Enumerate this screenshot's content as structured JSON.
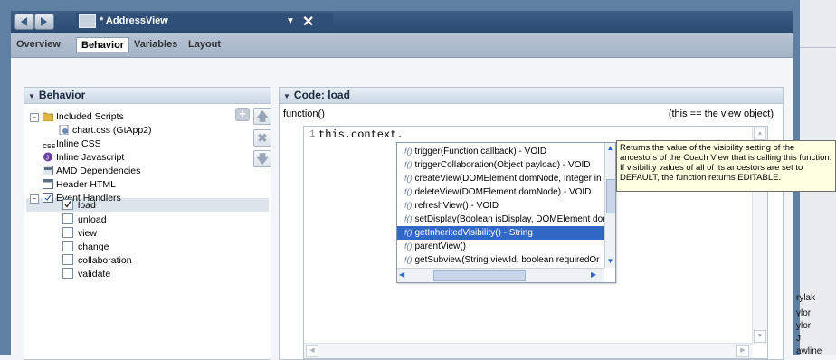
{
  "window": {
    "title": "* AddressView"
  },
  "tabs": [
    {
      "label": "Overview",
      "active": false
    },
    {
      "label": "Behavior",
      "active": true
    },
    {
      "label": "Variables",
      "active": false
    },
    {
      "label": "Layout",
      "active": false
    }
  ],
  "behavior_panel": {
    "title": "Behavior",
    "items": [
      {
        "label": "Included Scripts",
        "icon": "folder-icon"
      },
      {
        "label": "chart.css (GtApp2)",
        "icon": "css-file-icon"
      },
      {
        "label": "Inline CSS",
        "icon": "css-icon"
      },
      {
        "label": "Inline Javascript",
        "icon": "javascript-icon"
      },
      {
        "label": "AMD Dependencies",
        "icon": "module-icon"
      },
      {
        "label": "Header HTML",
        "icon": "html-icon"
      },
      {
        "label": "Event Handlers",
        "icon": "event-handlers-icon"
      }
    ],
    "handlers": [
      {
        "label": "load",
        "checked": true
      },
      {
        "label": "unload",
        "checked": false
      },
      {
        "label": "view",
        "checked": false
      },
      {
        "label": "change",
        "checked": false
      },
      {
        "label": "collaboration",
        "checked": false
      },
      {
        "label": "validate",
        "checked": false
      }
    ]
  },
  "code_panel": {
    "title": "Code: load",
    "signature": "function()",
    "note": "(this == the view object)",
    "line_number": "1",
    "code": "this.context."
  },
  "autocomplete": {
    "items": [
      "trigger(Function callback) - VOID",
      "triggerCollaboration(Object payload) - VOID",
      "createView(DOMElement domNode, Integer in",
      "deleteView(DOMElement domNode) - VOID",
      "refreshView() - VOID",
      "setDisplay(Boolean isDisplay, DOMElement dor",
      "getInheritedVisibility() - String",
      "parentView()",
      "getSubview(String viewId, boolean requiredOr"
    ],
    "selected_index": 6,
    "item_icon": "f()"
  },
  "tooltip": {
    "text": "Returns the value of the visibility setting of the ancestors of the Coach View that is calling this function. If visibility values of all of its ancestors are set to DEFAULT, the function returns EDITABLE."
  },
  "right_edge": [
    "rylak",
    "ylor",
    "ylor",
    "J",
    "awline"
  ]
}
